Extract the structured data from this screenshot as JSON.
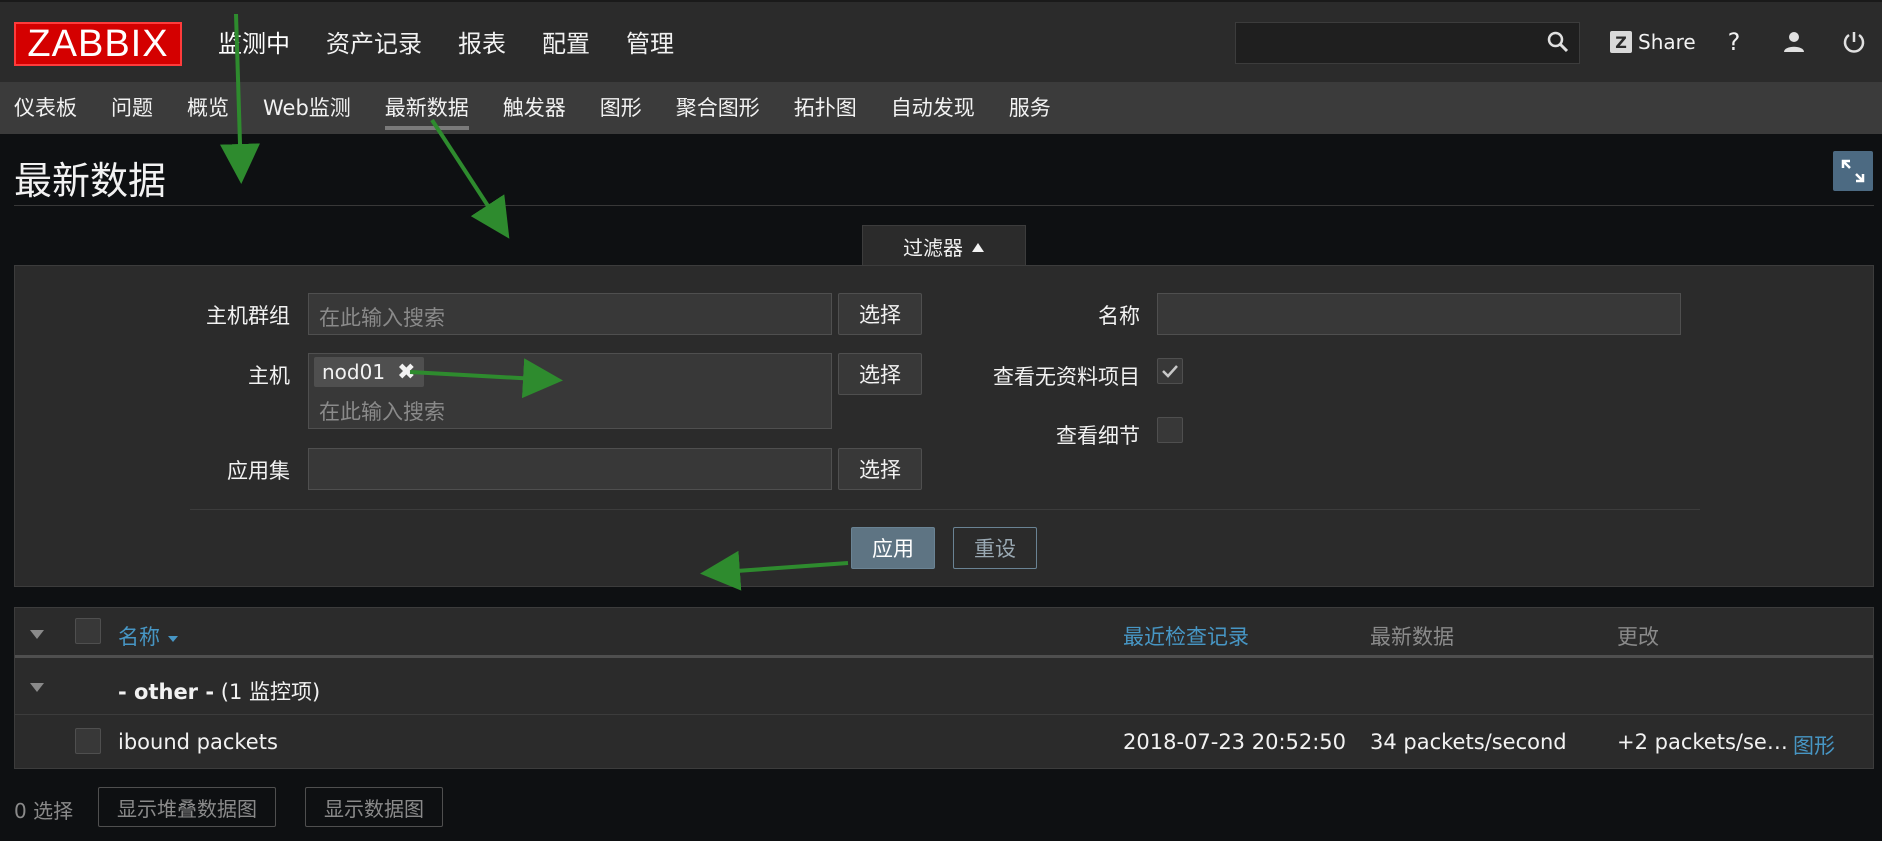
{
  "header": {
    "logo": "ZABBIX",
    "nav": [
      "监测中",
      "资产记录",
      "报表",
      "配置",
      "管理"
    ],
    "share_label": "Share",
    "help_glyph": "?"
  },
  "subnav": [
    "仪表板",
    "问题",
    "概览",
    "Web监测",
    "最新数据",
    "触发器",
    "图形",
    "聚合图形",
    "拓扑图",
    "自动发现",
    "服务"
  ],
  "page": {
    "title": "最新数据"
  },
  "filter": {
    "tab_label": "过滤器",
    "host_group_label": "主机群组",
    "host_label": "主机",
    "application_label": "应用集",
    "name_label": "名称",
    "show_no_data_label": "查看无资料项目",
    "show_details_label": "查看细节",
    "search_placeholder": "在此输入搜索",
    "select_label": "选择",
    "host_chip": "nod01",
    "apply_label": "应用",
    "reset_label": "重设",
    "show_no_data_checked": true,
    "show_details_checked": false
  },
  "table": {
    "columns": {
      "name": "名称",
      "last_check": "最近检查记录",
      "last_value": "最新数据",
      "change": "更改"
    },
    "group": {
      "name": "- other -",
      "count": "(1 监控项)"
    },
    "rows": [
      {
        "name": "ibound packets",
        "last_check": "2018-07-23 20:52:50",
        "last_value": "34 packets/second",
        "change": "+2 packets/se…",
        "link": "图形"
      }
    ]
  },
  "footer": {
    "selected": "0 选择",
    "stacked_graph_label": "显示堆叠数据图",
    "graph_label": "显示数据图"
  },
  "colors": {
    "logo_red": "#d40000",
    "link_blue": "#4796c4",
    "apply_blue": "#5e7483",
    "arrow_green": "#2e8b2e"
  }
}
